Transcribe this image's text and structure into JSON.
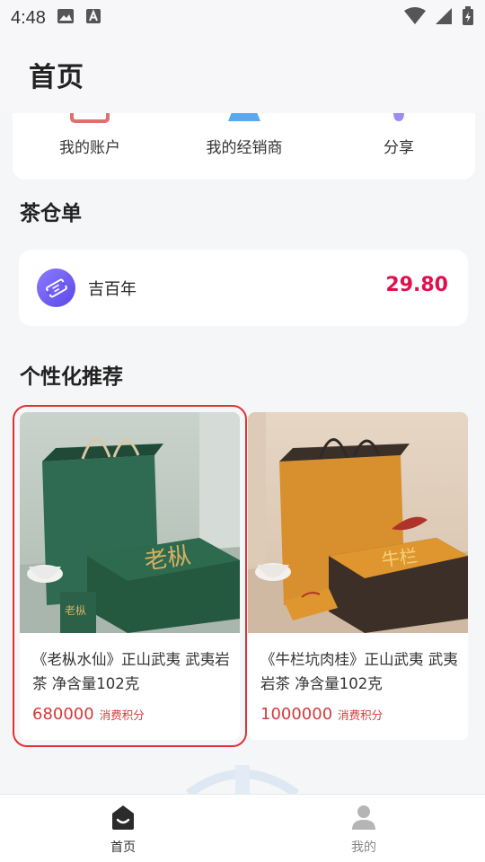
{
  "status_bar": {
    "time": "4:48",
    "icons": [
      "image-icon",
      "font-a-icon",
      "wifi-icon",
      "signal-icon",
      "battery-charging-icon"
    ]
  },
  "header": {
    "title": "首页"
  },
  "quick_actions": {
    "items": [
      {
        "label": "我的账户",
        "icon": "account-icon",
        "color": "#e07070"
      },
      {
        "label": "我的经销商",
        "icon": "dealer-icon",
        "color": "#5aa9f0"
      },
      {
        "label": "分享",
        "icon": "share-icon",
        "color": "#9b8cf0"
      }
    ]
  },
  "warehouse": {
    "title": "茶仓单",
    "item": {
      "name": "吉百年",
      "value": "29.80",
      "icon": "ticket-icon"
    }
  },
  "recommend": {
    "title": "个性化推荐",
    "products": [
      {
        "title": "《老枞水仙》正山武夷 武夷岩茶 净含量102克",
        "price": "680000",
        "price_unit": "消费积分",
        "image": "green-tea-gift-box",
        "theme_color": "#2f6b52"
      },
      {
        "title": "《牛栏坑肉桂》正山武夷 武夷岩茶 净含量102克",
        "price": "1000000",
        "price_unit": "消费积分",
        "image": "orange-tea-gift-box",
        "theme_color": "#d8902e"
      }
    ]
  },
  "tab_bar": {
    "items": [
      {
        "label": "首页",
        "icon": "home-smile-icon",
        "active": true
      },
      {
        "label": "我的",
        "icon": "user-icon",
        "active": false
      }
    ]
  },
  "colors": {
    "accent_red": "#e0104d",
    "price_red": "#d33a3a",
    "highlight": "#e03232"
  }
}
